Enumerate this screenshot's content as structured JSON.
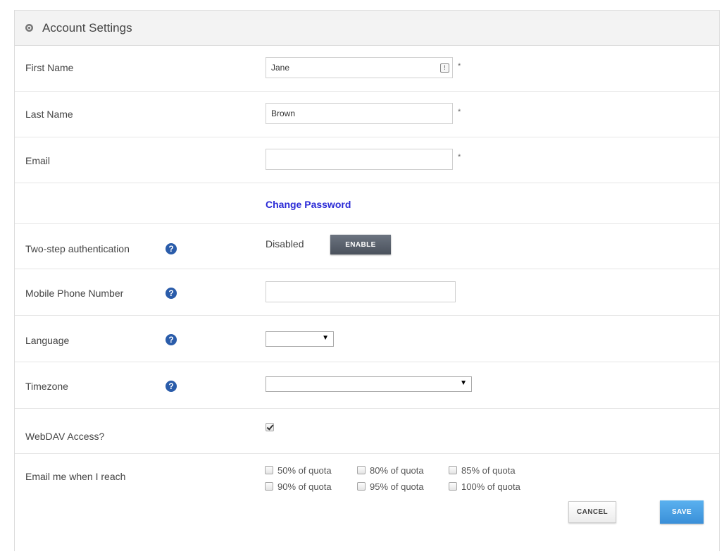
{
  "header": {
    "title": "Account Settings"
  },
  "form": {
    "first_name": {
      "label": "First Name",
      "value": "Jane",
      "required_mark": "*"
    },
    "last_name": {
      "label": "Last Name",
      "value": "Brown",
      "required_mark": "*"
    },
    "email": {
      "label": "Email",
      "value": "",
      "required_mark": "*"
    },
    "change_password": {
      "label": "Change Password"
    },
    "two_step": {
      "label": "Two-step authentication",
      "status": "Disabled",
      "button": "ENABLE"
    },
    "mobile_phone": {
      "label": "Mobile Phone Number",
      "value": ""
    },
    "language": {
      "label": "Language",
      "selected": ""
    },
    "timezone": {
      "label": "Timezone",
      "selected": ""
    },
    "webdav": {
      "label": "WebDAV Access?",
      "checked": true
    },
    "email_quota": {
      "label": "Email me when I reach",
      "options": [
        {
          "label": "50% of quota",
          "checked": false
        },
        {
          "label": "80% of quota",
          "checked": false
        },
        {
          "label": "85% of quota",
          "checked": false
        },
        {
          "label": "90% of quota",
          "checked": false
        },
        {
          "label": "95% of quota",
          "checked": false
        },
        {
          "label": "100% of quota",
          "checked": false
        }
      ]
    }
  },
  "actions": {
    "cancel": "CANCEL",
    "save": "SAVE"
  },
  "icons": {
    "header": "gear-icon",
    "help": "help-icon",
    "field_badge": "alert-badge-icon"
  },
  "colors": {
    "link": "#2b2bd6",
    "help_icon": "#2a5caa",
    "save_button": "#3a8fd8",
    "enable_button": "#4a515c"
  }
}
